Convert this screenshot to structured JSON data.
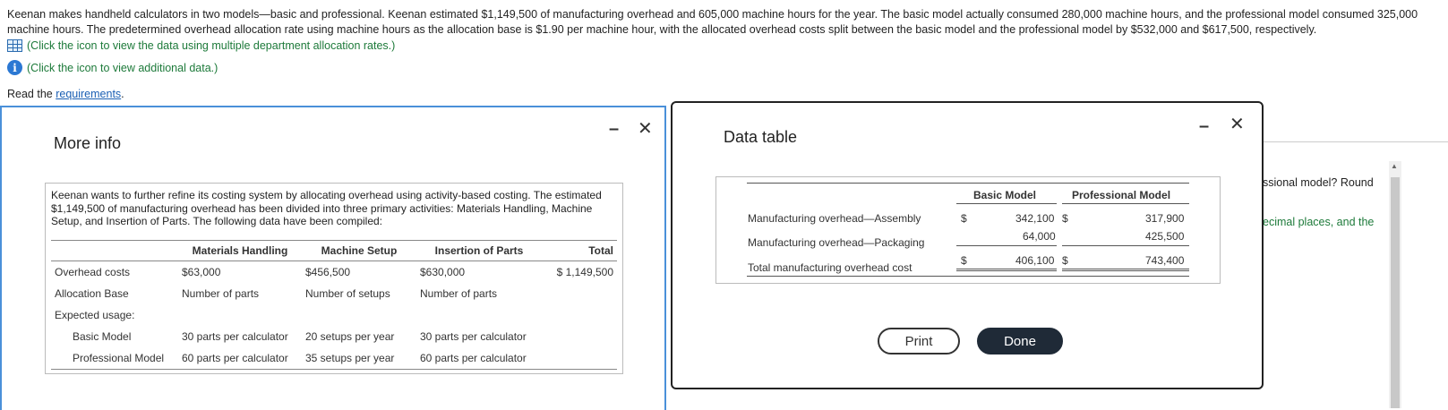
{
  "problem": {
    "text": "Keenan makes handheld calculators in two models—basic and professional. Keenan estimated $1,149,500 of manufacturing overhead and 605,000 machine hours for the year. The basic model actually consumed 280,000 machine hours, and the professional model consumed 325,000 machine hours. The predetermined overhead allocation rate using machine hours as the allocation base is $1.90 per machine hour, with the allocated overhead costs split between the basic model and the professional model by $532,000 and $617,500, respectively.",
    "link1": "(Click the icon to view the data using multiple department allocation rates.)",
    "link2": "(Click the icon to view additional data.)",
    "read_prefix": "Read the ",
    "read_link": "requirements",
    "read_suffix": "."
  },
  "background": {
    "text1": "ssional model? Round",
    "text2": "ecimal places, and the"
  },
  "more_info": {
    "title": "More info",
    "minimize": "–",
    "close": "✕",
    "description": "Keenan wants to further refine its costing system by allocating overhead using activity-based costing. The estimated $1,149,500 of manufacturing overhead has been divided into three primary activities: Materials Handling, Machine Setup, and Insertion of Parts. The following data have been compiled:",
    "headers": [
      "",
      "Materials Handling",
      "Machine Setup",
      "Insertion of Parts",
      "Total"
    ],
    "rows": [
      [
        "Overhead costs",
        "$63,000",
        "$456,500",
        "$630,000",
        "$ 1,149,500"
      ],
      [
        "Allocation Base",
        "Number of parts",
        "Number of setups",
        "Number of parts",
        ""
      ],
      [
        "Expected usage:",
        "",
        "",
        "",
        ""
      ],
      [
        "Basic Model",
        "30 parts per calculator",
        "20 setups per year",
        "30 parts per calculator",
        ""
      ],
      [
        "Professional Model",
        "60 parts per calculator",
        "35 setups per year",
        "60 parts per calculator",
        ""
      ]
    ]
  },
  "data_table": {
    "title": "Data table",
    "minimize": "–",
    "close": "✕",
    "col_basic": "Basic Model",
    "col_prof": "Professional Model",
    "rows": [
      {
        "label": "Manufacturing overhead—Assembly",
        "sym1": "$",
        "basic": "342,100",
        "sym2": "$",
        "prof": "317,900"
      },
      {
        "label": "Manufacturing overhead—Packaging",
        "sym1": "",
        "basic": "64,000",
        "sym2": "",
        "prof": "425,500"
      },
      {
        "label": "Total manufacturing overhead cost",
        "sym1": "$",
        "basic": "406,100",
        "sym2": "$",
        "prof": "743,400"
      }
    ],
    "print_label": "Print",
    "done_label": "Done"
  }
}
